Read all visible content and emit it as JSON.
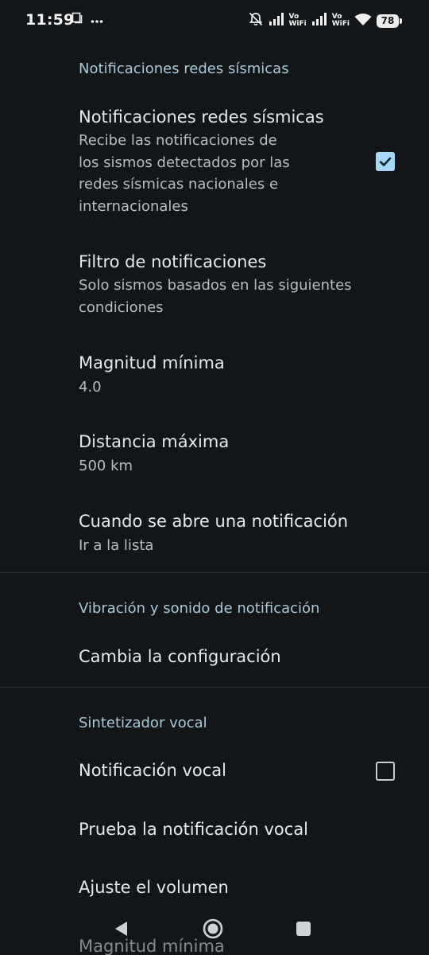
{
  "status_bar": {
    "time": "11:59",
    "vowifi_1": [
      "Vo",
      "WiFi"
    ],
    "vowifi_2": [
      "Vo",
      "WiFi"
    ],
    "battery": "78"
  },
  "sections": {
    "seismic": {
      "header": "Notificaciones redes sísmicas",
      "notifications_title": "Notificaciones redes sísmicas",
      "notifications_summary": [
        "Recibe las notificaciones de",
        "los sismos detectados por las",
        "redes sísmicas nacionales e",
        "internacionales"
      ],
      "notifications_checked": true,
      "filter_title": "Filtro de notificaciones",
      "filter_summary": [
        "Solo sismos basados en las siguientes",
        "condiciones"
      ],
      "min_magnitude_title": "Magnitud mínima",
      "min_magnitude_value": "4.0",
      "max_distance_title": "Distancia máxima",
      "max_distance_value": "500 km",
      "on_open_title": "Cuando se abre una notificación",
      "on_open_value": "Ir a la lista"
    },
    "vibration": {
      "header": "Vibración y sonido de notificación",
      "change_settings_title": "Cambia la configuración"
    },
    "voice": {
      "header": "Sintetizador vocal",
      "voice_notification_title": "Notificación vocal",
      "voice_notification_checked": false,
      "test_voice_title": "Prueba la notificación vocal",
      "adjust_volume_title": "Ajuste el volumen",
      "min_magnitude_title": "Magnitud mínima"
    }
  },
  "colors": {
    "background": "#121619",
    "section_header": "#A9C8DA",
    "checkbox_checked": "#A7D8F5"
  }
}
